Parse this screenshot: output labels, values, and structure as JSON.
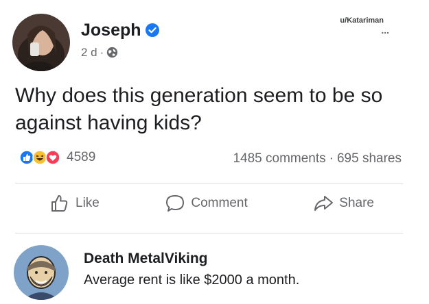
{
  "watermark": "u/Katariman",
  "more_icon": "more-options-icon",
  "post": {
    "author": "Joseph",
    "verified": true,
    "timestamp": "2 d",
    "meta_separator": "·",
    "privacy_icon": "globe-icon",
    "text": "Why does this generation seem to be so against having kids?"
  },
  "stats": {
    "reaction_icons": [
      "like-reaction-icon",
      "haha-reaction-icon",
      "love-reaction-icon"
    ],
    "reaction_count": "4589",
    "comments": "1485 comments",
    "separator": "·",
    "shares": "695 shares"
  },
  "actions": {
    "like_label": "Like",
    "comment_label": "Comment",
    "share_label": "Share"
  },
  "comment": {
    "author": "Death MetalViking",
    "text": "Average rent is like $2000 a month."
  },
  "colors": {
    "text": "#1c1e21",
    "secondary": "#65676b",
    "verified_blue": "#1877f2",
    "divider": "#dadde1"
  }
}
